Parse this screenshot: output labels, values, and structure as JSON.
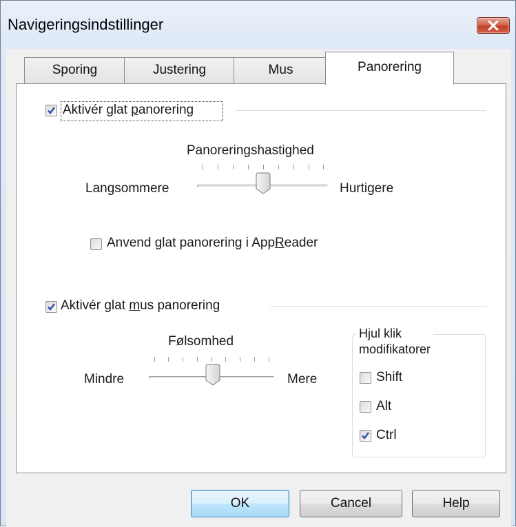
{
  "window": {
    "title": "Navigeringsindstillinger"
  },
  "tabs": [
    {
      "label": "Sporing",
      "active": false
    },
    {
      "label": "Justering",
      "active": false
    },
    {
      "label": "Mus",
      "active": false
    },
    {
      "label": "Panorering",
      "active": true
    }
  ],
  "smooth_pan": {
    "checkbox": {
      "prefix": "Aktivér glat ",
      "underlined": "p",
      "suffix": "anorering",
      "checked": true
    },
    "speed": {
      "title": "Panoreringshastighed",
      "min_label": "Langsommere",
      "max_label": "Hurtigere",
      "value_fraction": 0.5
    },
    "appreader": {
      "prefix": "Anvend glat panorering i App",
      "underlined": "R",
      "suffix": "eader",
      "checked": false
    }
  },
  "smooth_mouse_pan": {
    "checkbox": {
      "prefix": "Aktivér glat ",
      "underlined": "m",
      "suffix": "us panorering",
      "checked": true
    },
    "sensitivity": {
      "title": "Følsomhed",
      "min_label": "Mindre",
      "max_label": "Mere",
      "value_fraction": 0.5
    },
    "modifiers": {
      "title_line1": "Hjul klik",
      "title_line2": "modifikatorer",
      "items": [
        {
          "label": "Shift",
          "checked": false
        },
        {
          "label": "Alt",
          "checked": false
        },
        {
          "label": "Ctrl",
          "checked": true
        }
      ]
    }
  },
  "buttons": {
    "ok": "OK",
    "cancel": "Cancel",
    "help": "Help"
  },
  "colors": {
    "check": "#2a4ea6",
    "accent_blue": "#3c7fb1",
    "close_red": "#c2402a"
  }
}
